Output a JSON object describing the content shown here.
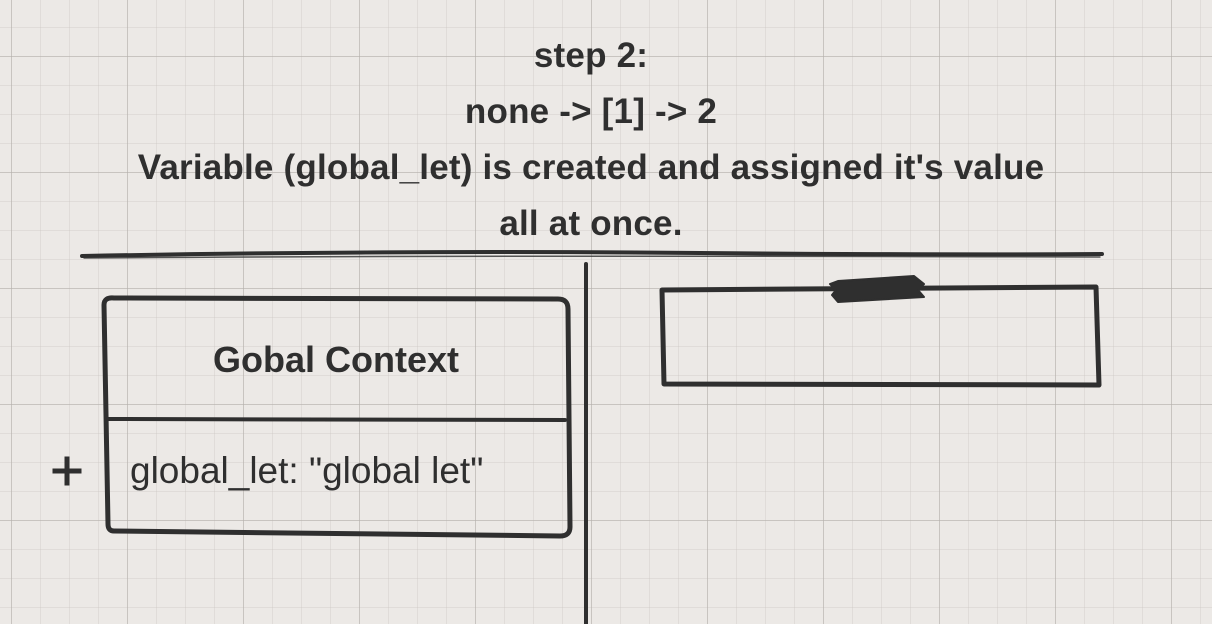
{
  "heading": {
    "line1": "step 2:",
    "line2": "none -> [1] -> 2",
    "line3": "Variable (global_let) is created and assigned it's value",
    "line4": "all at once."
  },
  "global_context": {
    "title": "Gobal Context",
    "rows": [
      {
        "text": "global_let: \"global let\""
      }
    ]
  },
  "icons": {
    "row_marker": "plus-icon",
    "tape": "tape-icon"
  },
  "colors": {
    "ink": "#2f2f2f",
    "canvas": "#ece9e6",
    "grid": "#b4b0ac"
  }
}
